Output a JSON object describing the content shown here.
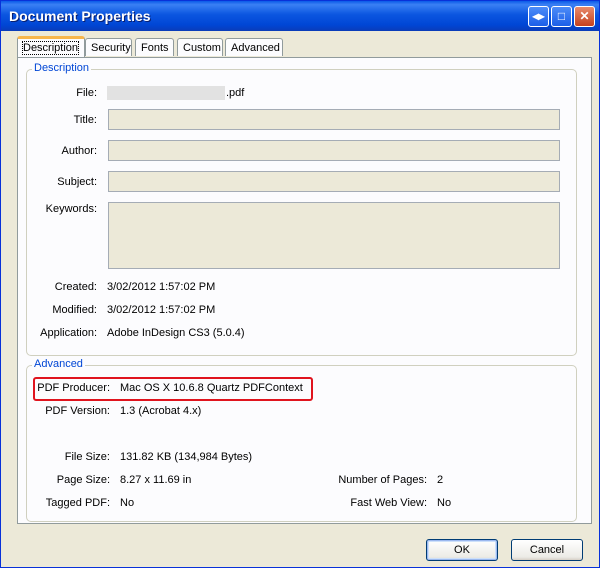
{
  "window": {
    "title": "Document Properties"
  },
  "titlebar_buttons": {
    "resize": "◂▸",
    "maximize": "□",
    "close": "✕"
  },
  "tabs": [
    {
      "label": "Description"
    },
    {
      "label": "Security"
    },
    {
      "label": "Fonts"
    },
    {
      "label": "Custom"
    },
    {
      "label": "Advanced"
    }
  ],
  "description": {
    "group_title": "Description",
    "file_label": "File:",
    "file_suffix": ".pdf",
    "title_label": "Title:",
    "title_value": "",
    "author_label": "Author:",
    "author_value": "",
    "subject_label": "Subject:",
    "subject_value": "",
    "keywords_label": "Keywords:",
    "keywords_value": "",
    "created_label": "Created:",
    "created_value": "3/02/2012 1:57:02 PM",
    "modified_label": "Modified:",
    "modified_value": "3/02/2012 1:57:02 PM",
    "application_label": "Application:",
    "application_value": "Adobe InDesign CS3 (5.0.4)"
  },
  "advanced": {
    "group_title": "Advanced",
    "producer_label": "PDF Producer:",
    "producer_value": "Mac OS X 10.6.8 Quartz PDFContext",
    "version_label": "PDF Version:",
    "version_value": "1.3 (Acrobat 4.x)",
    "filesize_label": "File Size:",
    "filesize_value": "131.82 KB (134,984 Bytes)",
    "pagesize_label": "Page Size:",
    "pagesize_value": "8.27 x 11.69 in",
    "numpages_label": "Number of Pages:",
    "numpages_value": "2",
    "tagged_label": "Tagged PDF:",
    "tagged_value": "No",
    "fastweb_label": "Fast Web View:",
    "fastweb_value": "No"
  },
  "footer": {
    "ok_label": "OK",
    "cancel_label": "Cancel"
  },
  "colors": {
    "titlebar": "#0054e3",
    "highlight": "#e0141e",
    "group_title": "#0046d5",
    "dialog_bg": "#ece9d8"
  }
}
